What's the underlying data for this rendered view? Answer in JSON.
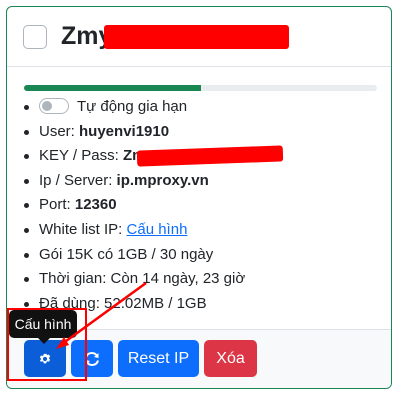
{
  "card": {
    "title": "Zmy",
    "progress_fraction": 0.5
  },
  "info": {
    "auto_renew_label": "Tự động gia hạn",
    "auto_renew_on": false,
    "user_label": "User:",
    "user_value": "huyenvi1910",
    "key_label": "KEY / Pass:",
    "key_value": "Zmy",
    "server_label": "Ip / Server:",
    "server_value": "ip.mproxy.vn",
    "port_label": "Port:",
    "port_value": "12360",
    "whitelist_label": "White list IP:",
    "whitelist_link": "Cấu hình",
    "package_text": "Gói 15K có 1GB / 30 ngày",
    "time_text": "Thời gian: Còn 14 ngày, 23 giờ",
    "used_text": "Đã dùng: 52.02MB / 1GB"
  },
  "footer": {
    "reset_ip_label": "Reset IP",
    "delete_label": "Xóa",
    "config_tooltip": "Cấu hình"
  },
  "colors": {
    "primary": "#0d6efd",
    "danger": "#dc3545",
    "success": "#198754",
    "annotation": "#ff0000"
  }
}
